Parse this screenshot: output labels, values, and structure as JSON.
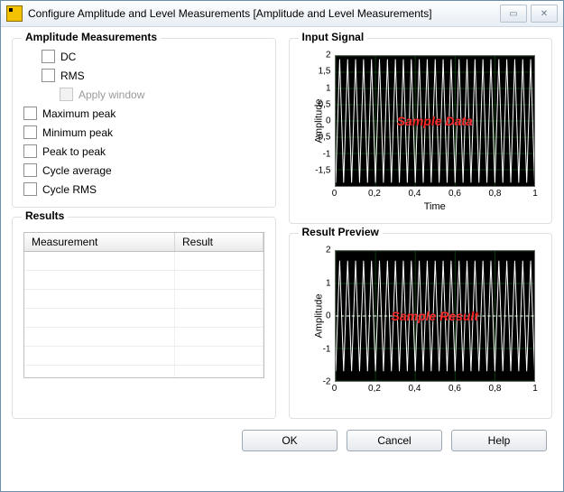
{
  "window": {
    "title": "Configure Amplitude and Level Measurements [Amplitude and Level Measurements]"
  },
  "amp": {
    "legend": "Amplitude Measurements",
    "dc": "DC",
    "rms": "RMS",
    "apply_window": "Apply window",
    "max_peak": "Maximum peak",
    "min_peak": "Minimum peak",
    "peak_to_peak": "Peak to peak",
    "cycle_avg": "Cycle average",
    "cycle_rms": "Cycle RMS"
  },
  "results": {
    "legend": "Results",
    "col_measurement": "Measurement",
    "col_result": "Result"
  },
  "input_signal": {
    "legend": "Input Signal",
    "overlay": "Sample Data",
    "ylabel": "Amplitude",
    "xlabel": "Time"
  },
  "result_preview": {
    "legend": "Result Preview",
    "overlay": "Sample Result",
    "ylabel": "Amplitude",
    "xlabel": ""
  },
  "buttons": {
    "ok": "OK",
    "cancel": "Cancel",
    "help": "Help"
  },
  "chart_data": [
    {
      "type": "line",
      "title": "Input Signal",
      "xlabel": "Time",
      "ylabel": "Amplitude",
      "xlim": [
        0,
        1
      ],
      "ylim": [
        -2,
        2
      ],
      "xticks": [
        0,
        0.2,
        0.4,
        0.6,
        0.8,
        1
      ],
      "yticks": [
        -1.5,
        -1,
        -0.5,
        0,
        0.5,
        1,
        1.5,
        2
      ],
      "overlay": "Sample Data",
      "waveform": {
        "shape": "triangle",
        "amplitude": 1.9,
        "cycles": 25
      }
    },
    {
      "type": "line",
      "title": "Result Preview",
      "xlabel": "",
      "ylabel": "Amplitude",
      "xlim": [
        0,
        1
      ],
      "ylim": [
        -2,
        2
      ],
      "xticks": [
        0,
        0.2,
        0.4,
        0.6,
        0.8,
        1
      ],
      "yticks": [
        -2,
        -1,
        0,
        1,
        2
      ],
      "overlay": "Sample Result",
      "waveform": {
        "shape": "triangle",
        "amplitude": 1.7,
        "cycles": 25
      },
      "dashed_line_y": 0
    }
  ]
}
